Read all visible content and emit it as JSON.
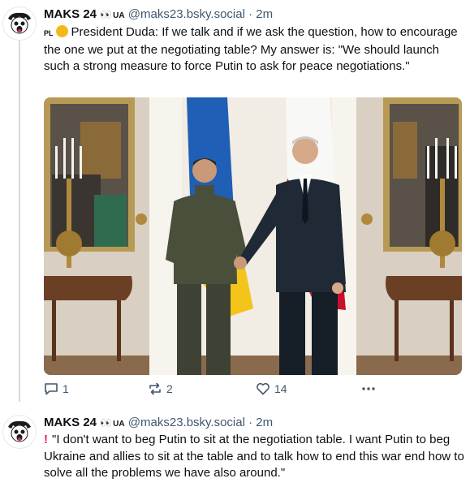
{
  "posts": [
    {
      "author": "MAKS 24",
      "emoji": "👀",
      "country": "UA",
      "handle": "@maks23.bsky.social",
      "separator": "·",
      "time": "2m",
      "lang_tag": "PL",
      "text": "President Duda: If we talk and if we ask the question, how to encourage the one we put at the negotiating table? My answer is: \"We should launch such a strong measure to force Putin to ask for peace negotiations.\"",
      "stats": {
        "replies": "1",
        "reposts": "2",
        "likes": "14"
      }
    },
    {
      "author": "MAKS 24",
      "emoji": "👀",
      "country": "UA",
      "handle": "@maks23.bsky.social",
      "separator": "·",
      "time": "2m",
      "text": "\"I don't want to beg Putin to sit at the negotiation table. I want Putin to beg Ukraine and allies to sit at the table and to talk how to end this war end how to solve all the problems we have also around.\""
    }
  ],
  "colors": {
    "text": "#0b0f14",
    "secondary": "#42576c",
    "thread_line": "#d4dbe2",
    "ukraine_blue": "#1f5fb5",
    "ukraine_yellow": "#f3c41a",
    "poland_red": "#c8102e"
  },
  "icons": [
    "reply-icon",
    "repost-icon",
    "like-icon",
    "more-icon",
    "clap-emoji",
    "exclamation-emoji"
  ]
}
